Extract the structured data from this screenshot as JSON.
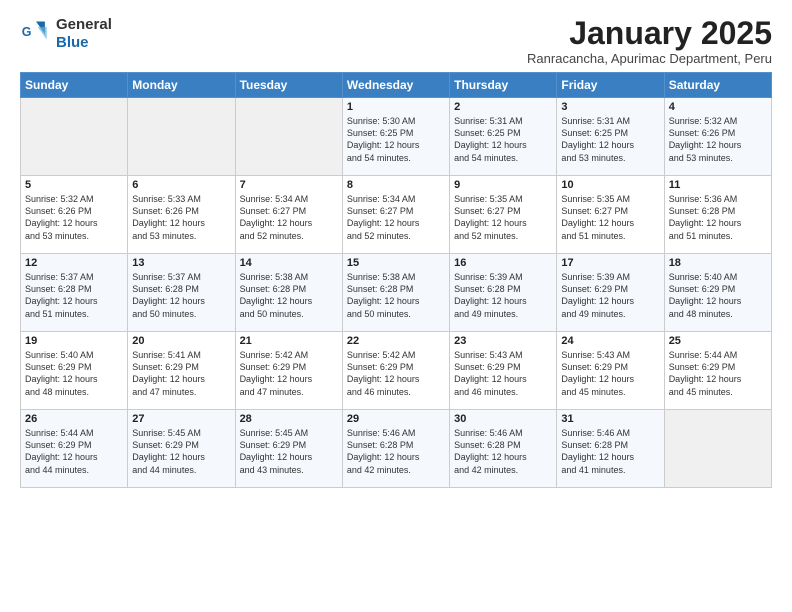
{
  "logo": {
    "line1": "General",
    "line2": "Blue"
  },
  "title": "January 2025",
  "subtitle": "Ranracancha, Apurimac Department, Peru",
  "days_of_week": [
    "Sunday",
    "Monday",
    "Tuesday",
    "Wednesday",
    "Thursday",
    "Friday",
    "Saturday"
  ],
  "weeks": [
    [
      {
        "day": "",
        "info": ""
      },
      {
        "day": "",
        "info": ""
      },
      {
        "day": "",
        "info": ""
      },
      {
        "day": "1",
        "info": "Sunrise: 5:30 AM\nSunset: 6:25 PM\nDaylight: 12 hours\nand 54 minutes."
      },
      {
        "day": "2",
        "info": "Sunrise: 5:31 AM\nSunset: 6:25 PM\nDaylight: 12 hours\nand 54 minutes."
      },
      {
        "day": "3",
        "info": "Sunrise: 5:31 AM\nSunset: 6:25 PM\nDaylight: 12 hours\nand 53 minutes."
      },
      {
        "day": "4",
        "info": "Sunrise: 5:32 AM\nSunset: 6:26 PM\nDaylight: 12 hours\nand 53 minutes."
      }
    ],
    [
      {
        "day": "5",
        "info": "Sunrise: 5:32 AM\nSunset: 6:26 PM\nDaylight: 12 hours\nand 53 minutes."
      },
      {
        "day": "6",
        "info": "Sunrise: 5:33 AM\nSunset: 6:26 PM\nDaylight: 12 hours\nand 53 minutes."
      },
      {
        "day": "7",
        "info": "Sunrise: 5:34 AM\nSunset: 6:27 PM\nDaylight: 12 hours\nand 52 minutes."
      },
      {
        "day": "8",
        "info": "Sunrise: 5:34 AM\nSunset: 6:27 PM\nDaylight: 12 hours\nand 52 minutes."
      },
      {
        "day": "9",
        "info": "Sunrise: 5:35 AM\nSunset: 6:27 PM\nDaylight: 12 hours\nand 52 minutes."
      },
      {
        "day": "10",
        "info": "Sunrise: 5:35 AM\nSunset: 6:27 PM\nDaylight: 12 hours\nand 51 minutes."
      },
      {
        "day": "11",
        "info": "Sunrise: 5:36 AM\nSunset: 6:28 PM\nDaylight: 12 hours\nand 51 minutes."
      }
    ],
    [
      {
        "day": "12",
        "info": "Sunrise: 5:37 AM\nSunset: 6:28 PM\nDaylight: 12 hours\nand 51 minutes."
      },
      {
        "day": "13",
        "info": "Sunrise: 5:37 AM\nSunset: 6:28 PM\nDaylight: 12 hours\nand 50 minutes."
      },
      {
        "day": "14",
        "info": "Sunrise: 5:38 AM\nSunset: 6:28 PM\nDaylight: 12 hours\nand 50 minutes."
      },
      {
        "day": "15",
        "info": "Sunrise: 5:38 AM\nSunset: 6:28 PM\nDaylight: 12 hours\nand 50 minutes."
      },
      {
        "day": "16",
        "info": "Sunrise: 5:39 AM\nSunset: 6:28 PM\nDaylight: 12 hours\nand 49 minutes."
      },
      {
        "day": "17",
        "info": "Sunrise: 5:39 AM\nSunset: 6:29 PM\nDaylight: 12 hours\nand 49 minutes."
      },
      {
        "day": "18",
        "info": "Sunrise: 5:40 AM\nSunset: 6:29 PM\nDaylight: 12 hours\nand 48 minutes."
      }
    ],
    [
      {
        "day": "19",
        "info": "Sunrise: 5:40 AM\nSunset: 6:29 PM\nDaylight: 12 hours\nand 48 minutes."
      },
      {
        "day": "20",
        "info": "Sunrise: 5:41 AM\nSunset: 6:29 PM\nDaylight: 12 hours\nand 47 minutes."
      },
      {
        "day": "21",
        "info": "Sunrise: 5:42 AM\nSunset: 6:29 PM\nDaylight: 12 hours\nand 47 minutes."
      },
      {
        "day": "22",
        "info": "Sunrise: 5:42 AM\nSunset: 6:29 PM\nDaylight: 12 hours\nand 46 minutes."
      },
      {
        "day": "23",
        "info": "Sunrise: 5:43 AM\nSunset: 6:29 PM\nDaylight: 12 hours\nand 46 minutes."
      },
      {
        "day": "24",
        "info": "Sunrise: 5:43 AM\nSunset: 6:29 PM\nDaylight: 12 hours\nand 45 minutes."
      },
      {
        "day": "25",
        "info": "Sunrise: 5:44 AM\nSunset: 6:29 PM\nDaylight: 12 hours\nand 45 minutes."
      }
    ],
    [
      {
        "day": "26",
        "info": "Sunrise: 5:44 AM\nSunset: 6:29 PM\nDaylight: 12 hours\nand 44 minutes."
      },
      {
        "day": "27",
        "info": "Sunrise: 5:45 AM\nSunset: 6:29 PM\nDaylight: 12 hours\nand 44 minutes."
      },
      {
        "day": "28",
        "info": "Sunrise: 5:45 AM\nSunset: 6:29 PM\nDaylight: 12 hours\nand 43 minutes."
      },
      {
        "day": "29",
        "info": "Sunrise: 5:46 AM\nSunset: 6:28 PM\nDaylight: 12 hours\nand 42 minutes."
      },
      {
        "day": "30",
        "info": "Sunrise: 5:46 AM\nSunset: 6:28 PM\nDaylight: 12 hours\nand 42 minutes."
      },
      {
        "day": "31",
        "info": "Sunrise: 5:46 AM\nSunset: 6:28 PM\nDaylight: 12 hours\nand 41 minutes."
      },
      {
        "day": "",
        "info": ""
      }
    ]
  ]
}
